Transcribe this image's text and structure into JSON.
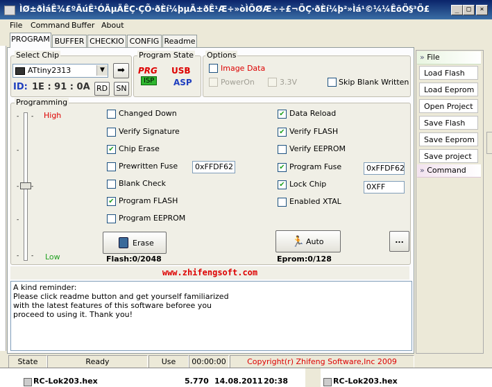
{
  "window": {
    "title": "ÌØ±ðÌáÊ¾£ºÄúÊ¹ÓÃµÄÊÇ·ÇÕ·ðÈí¼þµÄ±ðÊ¹Æ÷»òÌÕØÆ÷÷£¬ÖÇ·ðÈí¼þ²»Ìá¹©¼¼ÊõÖ§³Ö£",
    "minimize": "_",
    "maximize": "□",
    "close": "×"
  },
  "menu": [
    "File",
    "Command",
    "Buffer",
    "About"
  ],
  "tabs": [
    "PROGRAM",
    "BUFFER",
    "CHECKIO",
    "CONFIG",
    "Readme"
  ],
  "select_chip": {
    "label": "Select Chip",
    "chip": "ATtiny2313",
    "id_label": "ID:",
    "id_value": "1E : 91 : 0A",
    "rd": "RD",
    "sn": "SN"
  },
  "program_state": {
    "label": "Program State",
    "prg": "PRG",
    "isp": "ISP",
    "usb": "USB",
    "asp": "ASP"
  },
  "options": {
    "label": "Options",
    "image_data": "Image Data",
    "power_on": "PowerOn",
    "v33": "3.3V",
    "skip_blank": "Skip Blank Written"
  },
  "programming": {
    "label": "Programming",
    "high": "High",
    "low": "Low",
    "left": [
      {
        "label": "Changed Down",
        "checked": false
      },
      {
        "label": "Verify Signature",
        "checked": false
      },
      {
        "label": "Chip Erase",
        "checked": true
      },
      {
        "label": "Prewritten Fuse",
        "checked": false
      },
      {
        "label": "Blank Check",
        "checked": false
      },
      {
        "label": "Program FLASH",
        "checked": true
      },
      {
        "label": "Program EEPROM",
        "checked": false
      }
    ],
    "right": [
      {
        "label": "Data Reload",
        "checked": true
      },
      {
        "label": "Verify FLASH",
        "checked": true
      },
      {
        "label": "Verify EEPROM",
        "checked": false
      },
      {
        "label": "Program Fuse",
        "checked": true
      },
      {
        "label": "Lock Chip",
        "checked": true
      },
      {
        "label": "Enabled XTAL",
        "checked": false
      }
    ],
    "prewritten_fuse_value": "0xFFDF62",
    "program_fuse_value": "0xFFDF62",
    "lock_chip_value": "0XFF",
    "erase": "Erase",
    "auto": "Auto",
    "more": "...",
    "flash": "Flash:0/2048",
    "eprom": "Eprom:0/128"
  },
  "website": "www.zhifengsoft.com",
  "reminder": [
    "A kind reminder:",
    "Please click readme button and get yourself familiarized",
    "with the latest features of this software beforee you",
    "proceed to using it. Thank you!"
  ],
  "sidebar": {
    "file_header": "File",
    "buttons": [
      "Load Flash",
      "Load Eeprom",
      "Open Project",
      "Save Flash",
      "Save Eeprom",
      "Save project"
    ],
    "command_header": "Command"
  },
  "status": {
    "state_label": "State",
    "state_value": "Ready",
    "use_times_label": "Use Times",
    "use_times_value": "00:00:00",
    "copyright": "Copyright(r) Zhifeng Software,Inc 2009"
  },
  "background": {
    "left_file": "RC-Lok203.hex",
    "size": "5.770",
    "date": "14.08.2011",
    "time": "20:38",
    "right_file": "RC-Lok203.hex"
  },
  "colors": {
    "title_bar": "#0a246a",
    "high_low": "#cc0000",
    "website": "#cc0000",
    "copyright": "#cc0000",
    "check": "#21a121"
  }
}
